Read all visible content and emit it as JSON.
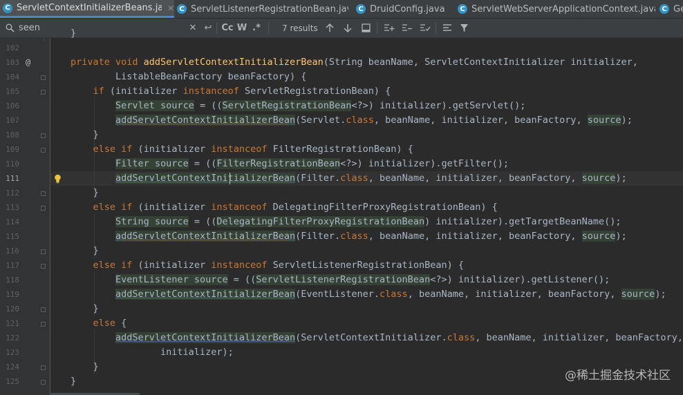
{
  "tabs": [
    {
      "label": "ServletContextInitializerBeans.java",
      "icon": "java-class-icon",
      "active": true,
      "closable": true
    },
    {
      "label": "ServletListenerRegistrationBean.java",
      "icon": "java-class-icon",
      "active": false,
      "closable": false
    },
    {
      "label": "DruidConfig.java",
      "icon": "java-class-icon",
      "active": false,
      "closable": false
    },
    {
      "label": "ServletWebServerApplicationContext.java",
      "icon": "java-class-icon",
      "active": false,
      "closable": false
    },
    {
      "label": "Ger",
      "icon": "java-class-icon",
      "active": false,
      "closable": false
    }
  ],
  "tab_icon_letter": "C",
  "search": {
    "value": "seen",
    "results": "7 results",
    "match_case_label": "Cc",
    "words_label": "W",
    "regex_label": ".*"
  },
  "editor": {
    "line_numbers": [
      "102",
      "103",
      "104",
      "105",
      "106",
      "107",
      "108",
      "109",
      "110",
      "111",
      "112",
      "113",
      "114",
      "115",
      "116",
      "117",
      "118",
      "119",
      "120",
      "121",
      "122",
      "123",
      "124",
      "125"
    ],
    "caret_line": "111",
    "annotation_line": "103"
  },
  "watermark": "@稀土掘金技术社区",
  "colors": {
    "background": "#2b2b2b",
    "keyword": "#cc7832",
    "method": "#ffc66d",
    "text": "#a9b7c6",
    "active_tab_underline": "#4a88c7"
  }
}
